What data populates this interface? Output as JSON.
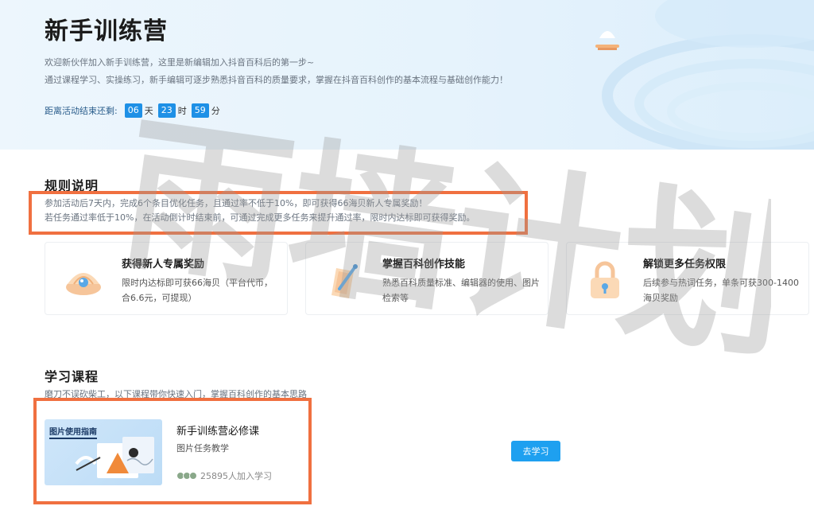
{
  "hero": {
    "title": "新手训练营",
    "desc_line1": "欢迎新伙伴加入新手训练营，这里是新编辑加入抖音百科后的第一步~",
    "desc_line2": "通过课程学习、实操练习，新手编辑可逐步熟悉抖音百科的质量要求，掌握在抖音百科创作的基本流程与基础创作能力！",
    "countdown": {
      "label": "距离活动结束还剩:",
      "days": "06",
      "days_unit": "天",
      "hours": "23",
      "hours_unit": "时",
      "minutes": "59",
      "minutes_unit": "分"
    }
  },
  "rules": {
    "title": "规则说明",
    "line1": "参加活动后7天内，完成6个条目优化任务，且通过率不低于10%，即可获得66海贝新人专属奖励！",
    "line2": "若任务通过率低于10%，在活动倒计时结束前，可通过完成更多任务来提升通过率，限时内达标即可获得奖励。"
  },
  "cards": [
    {
      "title": "获得新人专属奖励",
      "desc": "限时内达标即可获66海贝（平台代币，合6.6元，可提现）",
      "icon": "shell-pearl-icon"
    },
    {
      "title": "掌握百科创作技能",
      "desc": "熟悉百科质量标准、编辑器的使用、图片检索等",
      "icon": "pen-paper-icon"
    },
    {
      "title": "解锁更多任务权限",
      "desc": "后续参与热词任务，单条可获300-1400海贝奖励",
      "icon": "lock-icon"
    }
  ],
  "courses": {
    "title": "学习课程",
    "desc": "磨刀不误砍柴工，以下课程带你快速入门，掌握百科创作的基本思路",
    "item": {
      "thumb_label": "图片使用指南",
      "title": "新手训练营必修课",
      "subtitle": "图片任务教学",
      "stat": "25895人加入学习",
      "button": "去学习"
    }
  },
  "watermark": "雨墙计划",
  "colors": {
    "accent": "#1ea0f0",
    "highlight_border": "#f07040",
    "countdown_bg": "#1e90e6"
  }
}
